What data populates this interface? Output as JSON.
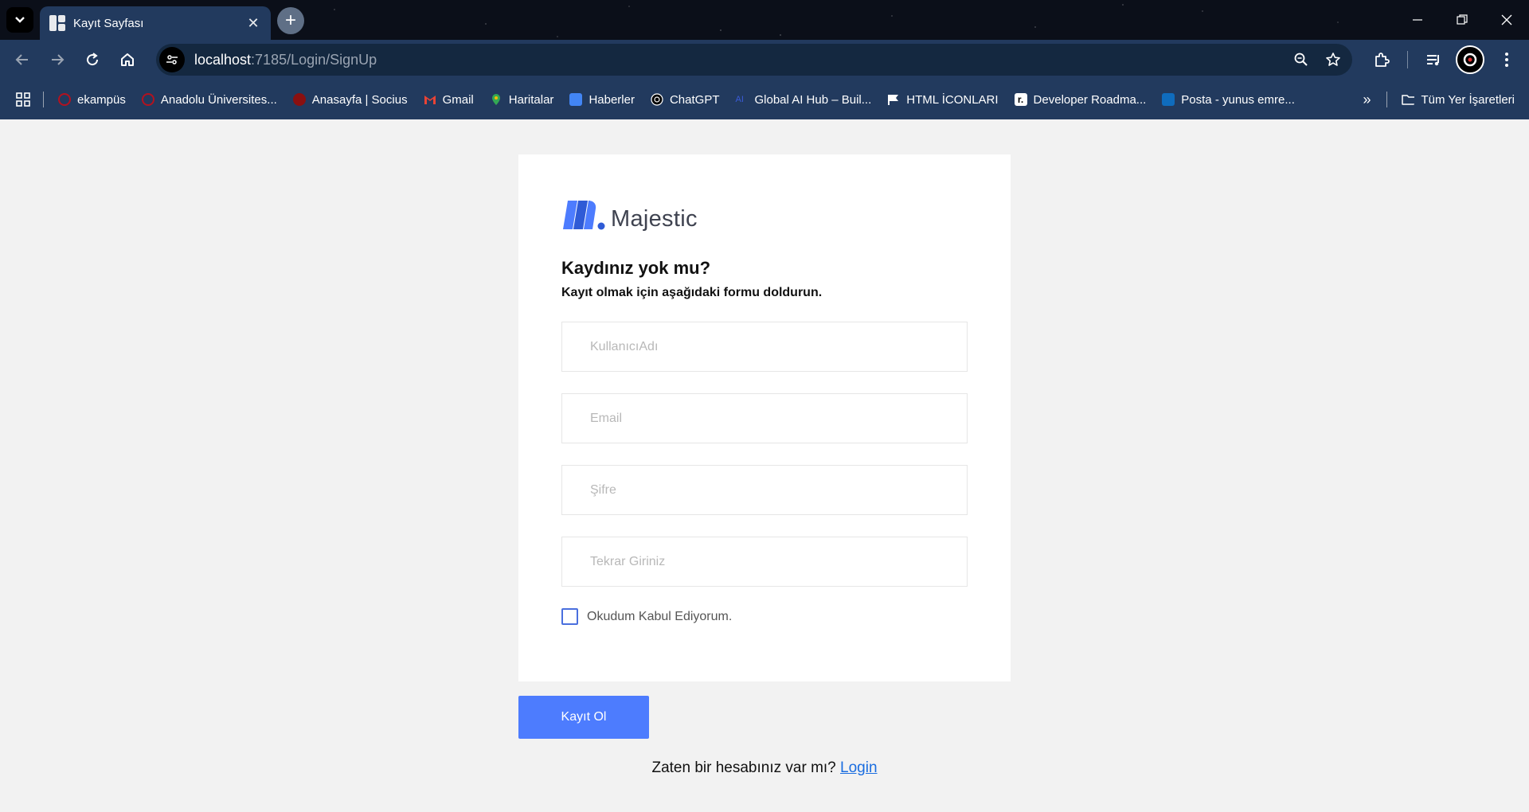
{
  "browser": {
    "tab_title": "Kayıt Sayfası",
    "url_host": "localhost",
    "url_path": ":7185/Login/SignUp",
    "new_tab_symbol": "+",
    "bookmarks": [
      {
        "label": "ekampüs",
        "icon": "anadolu-icon",
        "color": "#b3121f"
      },
      {
        "label": "Anadolu Üniversites...",
        "icon": "anadolu-icon",
        "color": "#b3121f"
      },
      {
        "label": "Anasayfa | Socius",
        "icon": "socius-icon",
        "color": "#8a1010"
      },
      {
        "label": "Gmail",
        "icon": "gmail-icon",
        "color": "#ea4335"
      },
      {
        "label": "Haritalar",
        "icon": "maps-icon",
        "color": "#34a853"
      },
      {
        "label": "Haberler",
        "icon": "news-icon",
        "color": "#4285f4"
      },
      {
        "label": "ChatGPT",
        "icon": "chatgpt-icon",
        "color": "#000000"
      },
      {
        "label": "Global AI Hub – Buil...",
        "icon": "ai-icon",
        "color": "#3a5bd9"
      },
      {
        "label": "HTML İCONLARI",
        "icon": "flag-icon",
        "color": "#ffffff"
      },
      {
        "label": "Developer Roadma...",
        "icon": "roadmap-icon",
        "color": "#000000"
      },
      {
        "label": "Posta - yunus emre...",
        "icon": "outlook-icon",
        "color": "#0f6cbd"
      }
    ],
    "all_bookmarks_label": "Tüm Yer İşaretleri"
  },
  "page": {
    "logo_text": "Majestic",
    "heading": "Kaydınız yok mu?",
    "subheading": "Kayıt olmak için aşağıdaki formu doldurun.",
    "fields": {
      "username_placeholder": "KullanıcıAdı",
      "email_placeholder": "Email",
      "password_placeholder": "Şifre",
      "confirm_placeholder": "Tekrar Giriniz"
    },
    "checkbox_label": "Okudum Kabul Ediyorum.",
    "submit_label": "Kayıt Ol",
    "login_prompt": "Zaten bir hesabınız var mı?",
    "login_link": "Login"
  },
  "colors": {
    "accent": "#4d7cfe",
    "chrome": "#223a5e",
    "background": "#f2f2f2"
  }
}
